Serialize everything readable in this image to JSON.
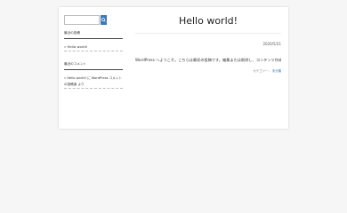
{
  "colors": {
    "accent": "#3b79b8",
    "page_background": "#f6f6f6",
    "card_background": "#ffffff"
  },
  "sidebar": {
    "search": {
      "placeholder": "",
      "button_icon": "search-icon"
    },
    "recent_posts": {
      "title": "最近の投稿",
      "items": [
        {
          "label": "» Hello world!"
        }
      ]
    },
    "recent_comments": {
      "title": "最近のコメント",
      "items": [
        {
          "label": "» Hello world! に WordPress コメントの投稿者 より"
        }
      ]
    }
  },
  "post": {
    "title": "Hello world!",
    "date": "2020/5/21",
    "body": "WordPress へようこそ。こちらは最初の投稿です。編集または削除し、コンテンツ作成を始めてください。",
    "meta_label": "カテゴリー：",
    "meta_link": "未分類"
  }
}
